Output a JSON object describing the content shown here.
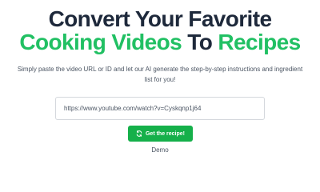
{
  "hero": {
    "headline_line1": "Convert Your Favorite",
    "headline_line2_part1": "Cooking Videos",
    "headline_line2_part2": "To",
    "headline_line2_part3": "Recipes",
    "subtitle": "Simply paste the video URL or ID and let our AI generate the step-by-step instructions and ingredient list for you!"
  },
  "form": {
    "url_value": "https://www.youtube.com/watch?v=Cyskqnp1j64",
    "submit_label": "Get the recipe!",
    "submit_icon": "refresh-icon"
  },
  "demo_link": "Demo",
  "colors": {
    "accent_green": "#21c063",
    "button_green": "#15b04a",
    "heading_dark": "#1e293b"
  }
}
